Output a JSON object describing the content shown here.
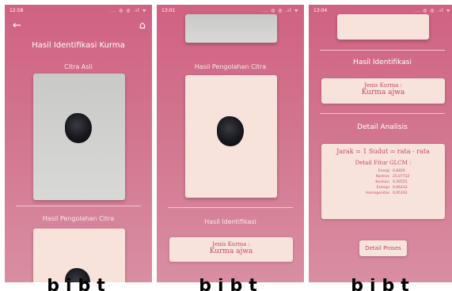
{
  "screen1": {
    "time": "12:58",
    "status_icons": "... ◎ ◎ .ıl ᯤ",
    "title": "Hasil Identifikasi Kurma",
    "label_original": "Citra Asli",
    "label_processing": "Hasil Pengolahan Citra"
  },
  "screen2": {
    "time": "13:01",
    "status_icons": "... ◎ ◎ .ıl ᯤ",
    "label_processing": "Hasil Pengolahan Citra",
    "label_identification": "Hasil Identifikasi",
    "result_key": "Jenis Kurma :",
    "result_value": "Kurma ajwa"
  },
  "screen3": {
    "time": "13:04",
    "status_icons": "... ◎ ◎ .ıl ᯤ",
    "label_identification": "Hasil Identifikasi",
    "result_key": "Jenis Kurma :",
    "result_value": "Kurma ajwa",
    "label_detail": "Detail Analisis",
    "params": "Jarak = 1   Sudut = rata - rata",
    "glcm_title": "Detail Fitur GLCM :",
    "features": [
      {
        "name": "Energi",
        "value": "0,6826"
      },
      {
        "name": "Kontras",
        "value": "25,07732"
      },
      {
        "name": "Korelasi",
        "value": "0,30555"
      },
      {
        "name": "Entropi",
        "value": "0,66433"
      },
      {
        "name": "Homogenitas",
        "value": "0,95162"
      }
    ],
    "button_label": "Detail Proses"
  },
  "colors": {
    "gradient_top": "#d06282",
    "gradient_bottom": "#d98ea2",
    "card": "#f8e3dc",
    "accent_text": "#c24867"
  }
}
